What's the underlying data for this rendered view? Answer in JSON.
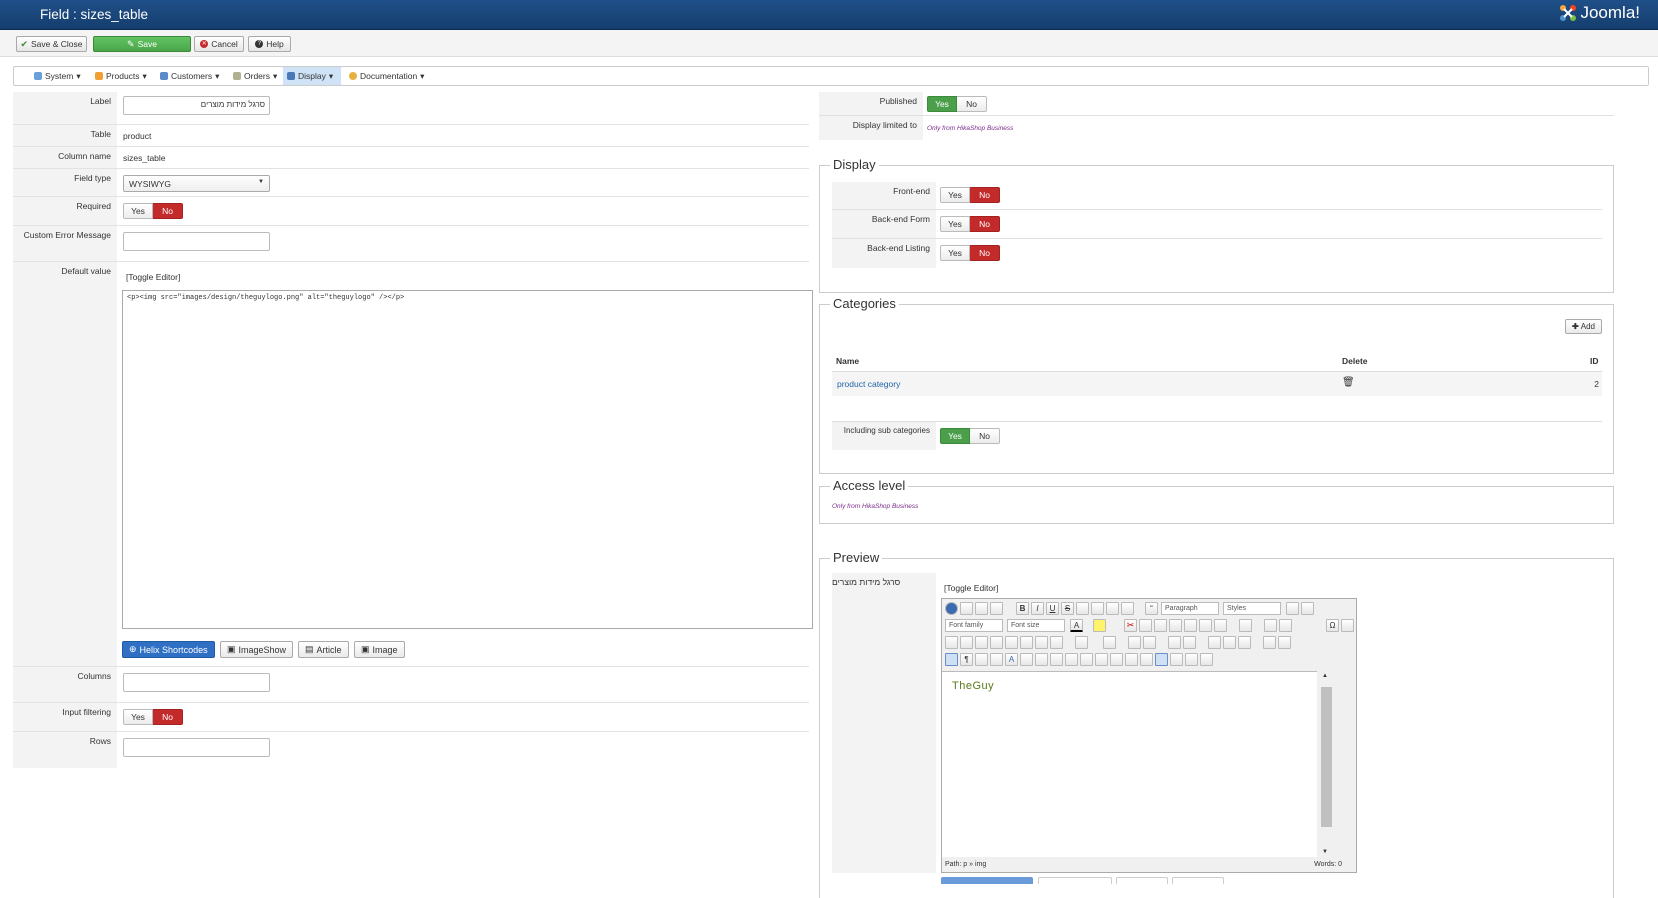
{
  "header": {
    "title": "Field : sizes_table",
    "brand": "Joomla!"
  },
  "toolbar": {
    "save_close": "Save & Close",
    "save": "Save",
    "cancel": "Cancel",
    "help": "Help"
  },
  "menu": [
    {
      "label": "System",
      "icon": "wrench-icon"
    },
    {
      "label": "Products",
      "icon": "products-icon"
    },
    {
      "label": "Customers",
      "icon": "customers-icon"
    },
    {
      "label": "Orders",
      "icon": "orders-icon"
    },
    {
      "label": "Display",
      "icon": "display-icon"
    },
    {
      "label": "Documentation",
      "icon": "documentation-icon"
    }
  ],
  "form": {
    "label": {
      "label": "Label",
      "value": "סרגל מידות מוצרים"
    },
    "table": {
      "label": "Table",
      "value": "product"
    },
    "column_name": {
      "label": "Column name",
      "value": "sizes_table"
    },
    "field_type": {
      "label": "Field type",
      "value": "WYSIWYG"
    },
    "required": {
      "label": "Required",
      "yes": "Yes",
      "no": "No",
      "selected": "No"
    },
    "custom_error": {
      "label": "Custom Error Message",
      "value": ""
    },
    "default_value": {
      "label": "Default value",
      "toggle": "[Toggle Editor]",
      "content": "<p><img src=\"images/design/theguylogo.png\" alt=\"theguylogo\" /></p>",
      "buttons": [
        "Helix Shortcodes",
        "ImageShow",
        "Article",
        "Image"
      ]
    },
    "columns": {
      "label": "Columns",
      "value": ""
    },
    "input_filtering": {
      "label": "Input filtering",
      "yes": "Yes",
      "no": "No",
      "selected": "No"
    },
    "rows": {
      "label": "Rows",
      "value": ""
    }
  },
  "right": {
    "published": {
      "label": "Published",
      "yes": "Yes",
      "no": "No",
      "selected": "Yes"
    },
    "display_limited": {
      "label": "Display limited to",
      "value": "Only from HikaShop Business"
    },
    "display": {
      "legend": "Display",
      "rows": [
        {
          "label": "Front-end",
          "yes": "Yes",
          "no": "No"
        },
        {
          "label": "Back-end Form",
          "yes": "Yes",
          "no": "No"
        },
        {
          "label": "Back-end Listing",
          "yes": "Yes",
          "no": "No"
        }
      ]
    },
    "categories": {
      "legend": "Categories",
      "add": "Add",
      "headers": {
        "name": "Name",
        "delete": "Delete",
        "id": "ID"
      },
      "items": [
        {
          "name": "product category",
          "id": "2"
        }
      ],
      "including_sub": {
        "label": "Including sub categories",
        "yes": "Yes",
        "no": "No"
      }
    },
    "access": {
      "legend": "Access level",
      "value": "Only from HikaShop Business"
    },
    "preview": {
      "legend": "Preview",
      "label": "סרגל מידות מוצרים",
      "toggle": "[Toggle Editor]",
      "format": "Paragraph",
      "styles": "Styles",
      "font_family": "Font family",
      "font_size": "Font size",
      "content": "TheGuy",
      "path": "Path:  p » img",
      "words": "Words: 0"
    }
  },
  "colors": {
    "header": "#1f4f88",
    "green": "#4b9f4b",
    "red": "#c32b2b",
    "link": "#1f63a8"
  }
}
